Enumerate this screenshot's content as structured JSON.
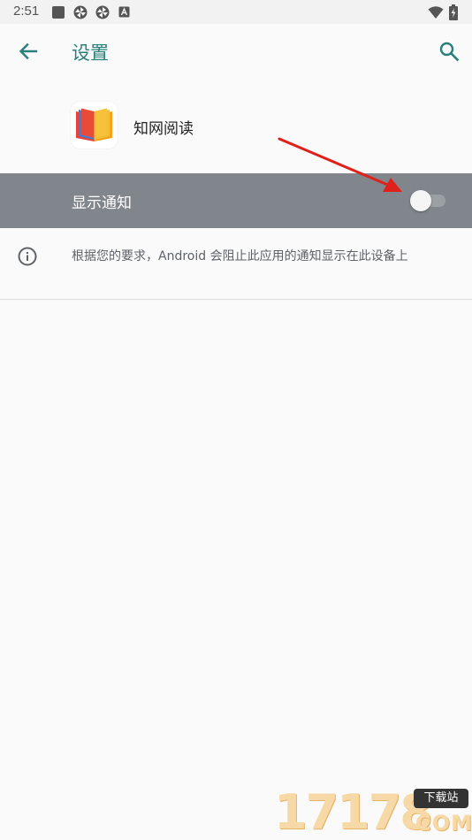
{
  "status_bar": {
    "time": "2:51",
    "left_icons": [
      "square-notification-icon",
      "pinwheel-icon",
      "pinwheel-icon",
      "a-letter-icon"
    ],
    "right_icons": [
      "wifi-icon",
      "battery-charging-icon"
    ]
  },
  "app_bar": {
    "title": "设置",
    "back_icon": "arrow-left-icon",
    "search_icon": "search-icon",
    "accent_color": "#2a7f7a"
  },
  "app_header": {
    "name": "知网阅读",
    "logo_icon": "open-book-icon"
  },
  "notification_row": {
    "label": "显示通知",
    "toggle_on": false,
    "background_color": "#80868b"
  },
  "info": {
    "text": "根据您的要求，Android 会阻止此应用的通知显示在此设备上",
    "icon": "info-icon"
  },
  "annotation": {
    "arrow_color": "#e0201b"
  },
  "watermark": {
    "digits": "17178",
    "badge": "下载站",
    "suffix": "COM"
  }
}
